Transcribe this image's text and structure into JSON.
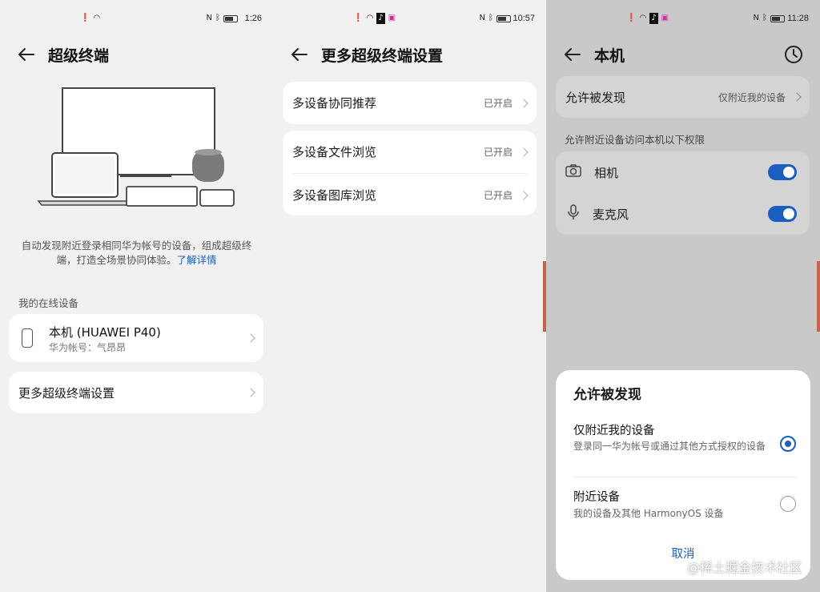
{
  "panel1": {
    "status": {
      "time": "1:26"
    },
    "title": "超级终端",
    "description": "自动发现附近登录相同华为帐号的设备，组成超级终端，打造全场景协同体验。",
    "learn_more": "了解详情",
    "section_label": "我的在线设备",
    "device": {
      "name": "本机 (HUAWEI P40)",
      "account": "华为帐号：气昂昂"
    },
    "more_settings": "更多超级终端设置"
  },
  "panel2": {
    "status": {
      "time": "10:57"
    },
    "title": "更多超级终端设置",
    "items": [
      {
        "label": "多设备协同推荐",
        "value": "已开启"
      },
      {
        "label": "多设备文件浏览",
        "value": "已开启"
      },
      {
        "label": "多设备图库浏览",
        "value": "已开启"
      }
    ]
  },
  "panel3": {
    "status": {
      "time": "11:28"
    },
    "title": "本机",
    "discover": {
      "label": "允许被发现",
      "value": "仅附近我的设备"
    },
    "permissions_label": "允许附近设备访问本机以下权限",
    "permissions": [
      {
        "label": "相机",
        "icon": "camera-icon",
        "enabled": true
      },
      {
        "label": "麦克风",
        "icon": "microphone-icon",
        "enabled": true
      }
    ],
    "sheet": {
      "title": "允许被发现",
      "options": [
        {
          "title": "仅附近我的设备",
          "desc": "登录同一华为帐号或通过其他方式授权的设备",
          "selected": true
        },
        {
          "title": "附近设备",
          "desc": "我的设备及其他 HarmonyOS 设备",
          "selected": false
        }
      ],
      "cancel": "取消"
    },
    "watermark": "@稀土掘金技术社区"
  },
  "colors": {
    "accent": "#1a5fbf",
    "edge": "#c9624d"
  }
}
